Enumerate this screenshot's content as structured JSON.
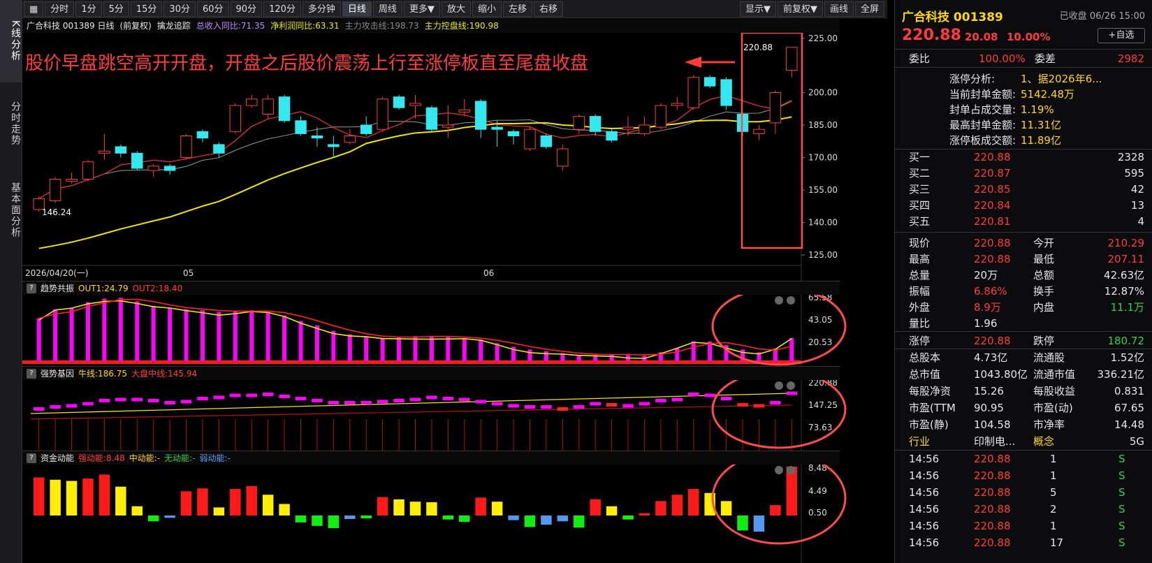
{
  "vtabs": [
    "K线分析",
    "分时走势",
    "基本面分析"
  ],
  "toolbar": {
    "left": [
      "分时",
      "1分",
      "5分",
      "15分",
      "30分",
      "60分",
      "90分",
      "120分",
      "多分钟",
      "日线",
      "周线",
      "更多▼",
      "放大",
      "缩小",
      "左移",
      "右移"
    ],
    "active": "日线",
    "right": [
      "显示▼",
      "前复权▼",
      "画线",
      "全屏"
    ]
  },
  "infobar": {
    "stock": "广合科技 001389 日线",
    "fuquan": "(前复权)",
    "indicator": "擒龙追踪",
    "rev": "总收入同比:71.35",
    "profit": "净利润同比:63.31",
    "attack": "主力攻击线:198.73",
    "control": "主力控盘线:190.98"
  },
  "annotation": "股价早盘跳空高开开盘，开盘之后股价震荡上行至涨停板直至尾盘收盘",
  "main_chart": {
    "yticks": [
      "225.00",
      "200.00",
      "185.00",
      "170.00",
      "155.00",
      "140.00",
      "125.00"
    ],
    "high_label": "220.88",
    "low_label": "146.24",
    "xlabels": [
      "2026/04/20(一)",
      "05",
      "06"
    ]
  },
  "panel1": {
    "name": "趋势共振",
    "out1": "OUT1:24.79",
    "out2": "OUT2:18.40",
    "yticks": [
      "65.58",
      "43.05",
      "20.53"
    ]
  },
  "panel2": {
    "name": "强势基因",
    "bull": "牛线:186.75",
    "market": "大盘中线:145.94",
    "yticks": [
      "220.88",
      "147.25",
      "73.63"
    ]
  },
  "panel3": {
    "name": "资金动能",
    "strong": "强动能:8.48",
    "mid": "中动能:-",
    "none": "无动能:-",
    "weak": "弱动能:-",
    "yticks": [
      "8.48",
      "4.49",
      "0.50"
    ]
  },
  "chart_data": {
    "type": "candlestick",
    "candles": [
      {
        "o": 146,
        "c": 151,
        "h": 152,
        "l": 145
      },
      {
        "o": 150,
        "c": 160,
        "h": 161,
        "l": 149
      },
      {
        "o": 159,
        "c": 160,
        "h": 163,
        "l": 158
      },
      {
        "o": 160,
        "c": 168,
        "h": 169,
        "l": 159
      },
      {
        "o": 172,
        "c": 173,
        "h": 181,
        "l": 169
      },
      {
        "o": 175,
        "c": 172,
        "h": 176,
        "l": 170
      },
      {
        "o": 172,
        "c": 165,
        "h": 173,
        "l": 164
      },
      {
        "o": 164,
        "c": 166,
        "h": 167,
        "l": 161
      },
      {
        "o": 166,
        "c": 164,
        "h": 167,
        "l": 162
      },
      {
        "o": 170,
        "c": 180,
        "h": 181,
        "l": 169
      },
      {
        "o": 182,
        "c": 179,
        "h": 183,
        "l": 177
      },
      {
        "o": 176,
        "c": 172,
        "h": 177,
        "l": 170
      },
      {
        "o": 182,
        "c": 194,
        "h": 195,
        "l": 181
      },
      {
        "o": 194,
        "c": 197,
        "h": 199,
        "l": 193
      },
      {
        "o": 190,
        "c": 197,
        "h": 199,
        "l": 188
      },
      {
        "o": 198,
        "c": 187,
        "h": 199,
        "l": 186
      },
      {
        "o": 187,
        "c": 181,
        "h": 189,
        "l": 180
      },
      {
        "o": 180,
        "c": 179,
        "h": 184,
        "l": 175
      },
      {
        "o": 176,
        "c": 175,
        "h": 180,
        "l": 170
      },
      {
        "o": 177,
        "c": 180,
        "h": 183,
        "l": 176
      },
      {
        "o": 185,
        "c": 181,
        "h": 189,
        "l": 180
      },
      {
        "o": 183,
        "c": 197,
        "h": 198,
        "l": 182
      },
      {
        "o": 198,
        "c": 193,
        "h": 199,
        "l": 192
      },
      {
        "o": 194,
        "c": 195,
        "h": 199,
        "l": 188
      },
      {
        "o": 193,
        "c": 183,
        "h": 194,
        "l": 182
      },
      {
        "o": 184,
        "c": 185,
        "h": 194,
        "l": 179
      },
      {
        "o": 191,
        "c": 192,
        "h": 197,
        "l": 189
      },
      {
        "o": 196,
        "c": 183,
        "h": 197,
        "l": 179
      },
      {
        "o": 184,
        "c": 183,
        "h": 187,
        "l": 175
      },
      {
        "o": 182,
        "c": 180,
        "h": 183,
        "l": 176
      },
      {
        "o": 174,
        "c": 183,
        "h": 184,
        "l": 173
      },
      {
        "o": 180,
        "c": 175,
        "h": 181,
        "l": 174
      },
      {
        "o": 166,
        "c": 174,
        "h": 176,
        "l": 164
      },
      {
        "o": 183,
        "c": 189,
        "h": 190,
        "l": 181
      },
      {
        "o": 189,
        "c": 182,
        "h": 190,
        "l": 180
      },
      {
        "o": 182,
        "c": 178,
        "h": 183,
        "l": 177
      },
      {
        "o": 183,
        "c": 184,
        "h": 189,
        "l": 180
      },
      {
        "o": 181,
        "c": 185,
        "h": 189,
        "l": 180
      },
      {
        "o": 184,
        "c": 194,
        "h": 195,
        "l": 183
      },
      {
        "o": 194,
        "c": 195,
        "h": 198,
        "l": 192
      },
      {
        "o": 193,
        "c": 207,
        "h": 208,
        "l": 192
      },
      {
        "o": 207,
        "c": 203,
        "h": 208,
        "l": 202
      },
      {
        "o": 206,
        "c": 194,
        "h": 207,
        "l": 192
      },
      {
        "o": 190,
        "c": 182,
        "h": 191,
        "l": 180
      },
      {
        "o": 181,
        "c": 183,
        "h": 185,
        "l": 178
      },
      {
        "o": 186,
        "c": 200,
        "h": 201,
        "l": 181
      },
      {
        "o": 210.29,
        "c": 220.88,
        "h": 220.88,
        "l": 207.11
      }
    ],
    "ma_red_last": 198.73,
    "ma_yellow_last": 190.98,
    "ylim": [
      125,
      225
    ]
  },
  "right_panel": {
    "title": "广合科技 001389",
    "status": "已收盘 06/26 15:00",
    "price": "220.88",
    "change": "20.08",
    "pct": "10.00%",
    "add_label": "+自选",
    "weibi_label": "委比",
    "weibi": "100.00%",
    "weicha_label": "委差",
    "weicha": "2982",
    "limit_info": [
      {
        "k": "涨停分析:",
        "v": "1、据2026年6..."
      },
      {
        "k": "当前封单金额:",
        "v": "5142.48万"
      },
      {
        "k": "封单占成交量:",
        "v": "1.19%"
      },
      {
        "k": "最高封单金额:",
        "v": "11.31亿"
      },
      {
        "k": "涨停板成交额:",
        "v": "11.89亿"
      }
    ],
    "bids": [
      {
        "name": "买一",
        "price": "220.88",
        "vol": "2328"
      },
      {
        "name": "买二",
        "price": "220.87",
        "vol": "595"
      },
      {
        "name": "买三",
        "price": "220.85",
        "vol": "42"
      },
      {
        "name": "买四",
        "price": "220.84",
        "vol": "13"
      },
      {
        "name": "买五",
        "price": "220.81",
        "vol": "4"
      }
    ],
    "quote": [
      {
        "k1": "现价",
        "v1": "220.88",
        "c1": "red",
        "k2": "今开",
        "v2": "210.29",
        "c2": "red"
      },
      {
        "k1": "最高",
        "v1": "220.88",
        "c1": "red",
        "k2": "最低",
        "v2": "207.11",
        "c2": "red"
      },
      {
        "k1": "总量",
        "v1": "20万",
        "c1": "white",
        "k2": "总额",
        "v2": "42.63亿",
        "c2": "white"
      },
      {
        "k1": "振幅",
        "v1": "6.86%",
        "c1": "red",
        "k2": "换手",
        "v2": "12.87%",
        "c2": "white"
      },
      {
        "k1": "外盘",
        "v1": "8.9万",
        "c1": "red",
        "k2": "内盘",
        "v2": "11.1万",
        "c2": "green"
      },
      {
        "k1": "量比",
        "v1": "1.96",
        "c1": "white",
        "k2": "",
        "v2": "",
        "c2": "white"
      },
      {
        "k1": "涨停",
        "v1": "220.88",
        "c1": "red",
        "k2": "跌停",
        "v2": "180.72",
        "c2": "green"
      },
      {
        "k1": "总股本",
        "v1": "4.73亿",
        "c1": "white",
        "k2": "流通股",
        "v2": "1.52亿",
        "c2": "white"
      },
      {
        "k1": "总市值",
        "v1": "1043.80亿",
        "c1": "white",
        "k2": "流通市值",
        "v2": "336.21亿",
        "c2": "white"
      },
      {
        "k1": "每股净资",
        "v1": "15.26",
        "c1": "white",
        "k2": "每股收益",
        "v2": "0.831",
        "c2": "white"
      },
      {
        "k1": "市盈(TTM",
        "v1": "90.95",
        "c1": "white",
        "k2": "市盈(动)",
        "v2": "67.65",
        "c2": "white"
      },
      {
        "k1": "市盈(静)",
        "v1": "104.58",
        "c1": "white",
        "k2": "市净率",
        "v2": "14.48",
        "c2": "white"
      }
    ],
    "industry_label": "行业",
    "industry": "印制电...",
    "concept_label": "概念",
    "concept": "5G",
    "ticks": [
      {
        "t": "14:56",
        "p": "220.88",
        "v": "1",
        "s": "S"
      },
      {
        "t": "14:56",
        "p": "220.88",
        "v": "1",
        "s": "S"
      },
      {
        "t": "14:56",
        "p": "220.88",
        "v": "5",
        "s": "S"
      },
      {
        "t": "14:56",
        "p": "220.88",
        "v": "2",
        "s": "S"
      },
      {
        "t": "14:56",
        "p": "220.88",
        "v": "1",
        "s": "S"
      },
      {
        "t": "14:56",
        "p": "220.88",
        "v": "17",
        "s": "S"
      }
    ]
  }
}
